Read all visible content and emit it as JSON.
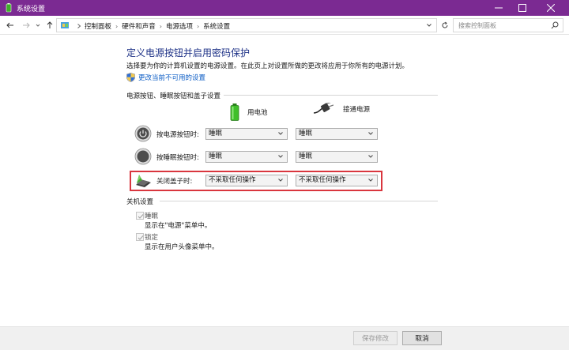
{
  "window": {
    "title": "系统设置"
  },
  "address": {
    "crumbs": [
      "控制面板",
      "硬件和声音",
      "电源选项",
      "系统设置"
    ],
    "search_placeholder": "搜索控制面板"
  },
  "page": {
    "title": "定义电源按钮并启用密码保护",
    "description": "选择要为你的计算机设置的电源设置。在此页上对设置所做的更改将应用于你所有的电源计划。",
    "change_link": "更改当前不可用的设置"
  },
  "buttons_section": {
    "title": "电源按钮、睡眠按钮和盖子设置",
    "battery_label": "用电池",
    "plugged_label": "接通电源",
    "rows": [
      {
        "label": "按电源按钮时:",
        "battery": "睡眠",
        "plugged": "睡眠"
      },
      {
        "label": "按睡眠按钮时:",
        "battery": "睡眠",
        "plugged": "睡眠"
      },
      {
        "label": "关闭盖子时:",
        "battery": "不采取任何操作",
        "plugged": "不采取任何操作"
      }
    ]
  },
  "shutdown_section": {
    "title": "关机设置",
    "items": [
      {
        "label": "睡眠",
        "desc": "显示在\"电源\"菜单中。",
        "checked": true
      },
      {
        "label": "锁定",
        "desc": "显示在用户头像菜单中。",
        "checked": true
      }
    ]
  },
  "footer": {
    "save_label": "保存修改",
    "cancel_label": "取消"
  },
  "colors": {
    "titlebar": "#7b2a92",
    "heading": "#1e3287",
    "link": "#0a5bc4",
    "highlight": "#d9363e"
  }
}
